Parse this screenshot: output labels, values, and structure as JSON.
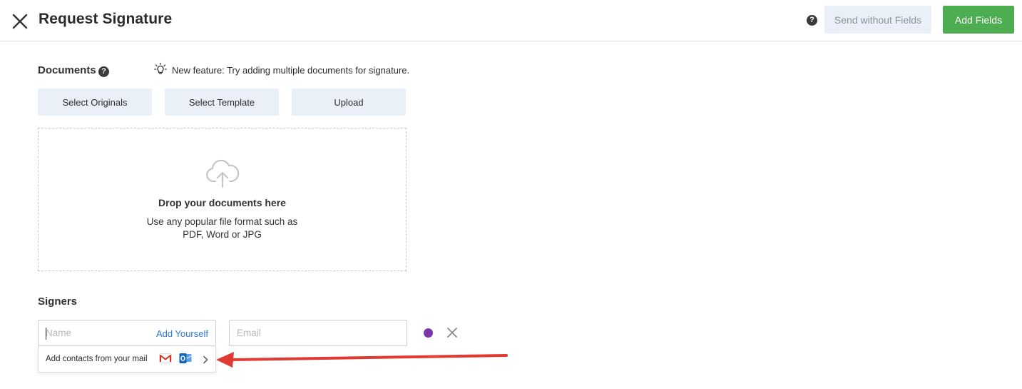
{
  "header": {
    "title": "Request Signature",
    "help_glyph": "?",
    "send_without_fields": "Send without Fields",
    "add_fields": "Add Fields"
  },
  "documents": {
    "label": "Documents",
    "help_glyph": "?",
    "feature_text": "New feature: Try adding multiple documents for signature.",
    "buttons": [
      "Select Originals",
      "Select Template",
      "Upload"
    ],
    "dropzone": {
      "title": "Drop your documents here",
      "desc_line1": "Use any popular file format such as",
      "desc_line2": "PDF, Word or JPG"
    }
  },
  "signers": {
    "label": "Signers",
    "name_placeholder": "Name",
    "add_yourself": "Add Yourself",
    "email_placeholder": "Email",
    "signer_color": "#7d36a8",
    "contacts_dropdown": {
      "text": "Add contacts from your mail"
    }
  },
  "icons": {
    "close": "close-icon",
    "bulb": "lightbulb-icon",
    "upload": "cloud-upload-icon",
    "gmail": "gmail-icon",
    "outlook": "outlook-icon",
    "chevron": "chevron-right-icon",
    "remove": "remove-signer-icon"
  },
  "colors": {
    "primary": "#4cae50",
    "secondary_bg": "#e9f0f8",
    "link": "#2a7bd5",
    "annotation_arrow": "#e03a33"
  }
}
